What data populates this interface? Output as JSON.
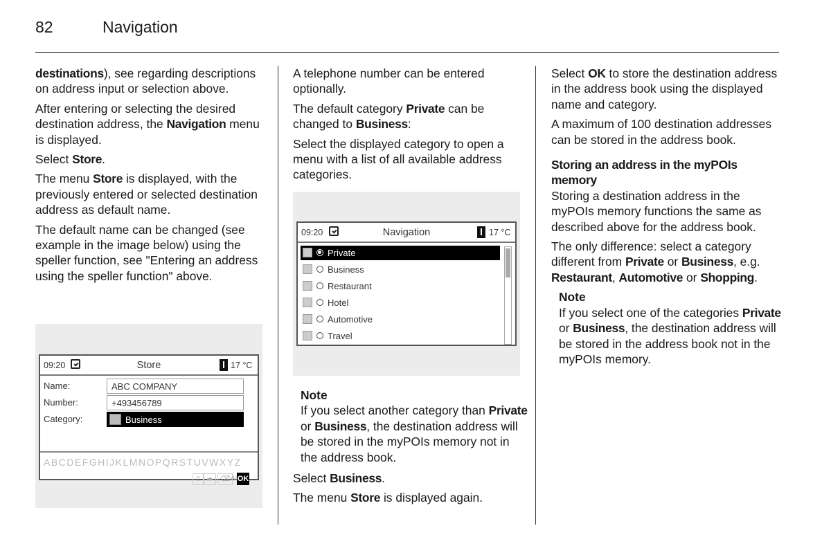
{
  "header": {
    "page_number": "82",
    "section_title": "Navigation"
  },
  "col1": {
    "p1_bold": "destinations",
    "p1_rest": "), see regarding descriptions on address input or selection above.",
    "p2_a": "After entering or selecting the desired destination address, the ",
    "p2_bold": "Navigation",
    "p2_b": " menu is displayed.",
    "p3_a": "Select ",
    "p3_bold": "Store",
    "p3_b": ".",
    "p4_a": "The menu ",
    "p4_bold": "Store",
    "p4_b": " is displayed, with the previously entered or selected destination address as default name.",
    "p5": "The default name can be changed (see example in the image below) using the speller function, see \"Entering an address using the speller function\" above."
  },
  "store_screen": {
    "time": "09:20",
    "title": "Store",
    "temperature": "17 °C",
    "fields": [
      {
        "label": "Name:",
        "value": "ABC COMPANY"
      },
      {
        "label": "Number:",
        "value": "+493456789"
      },
      {
        "label": "Category:",
        "value": "Business"
      }
    ],
    "alphabet": "ABCDEFGHIJKLMNOPQRSTUVWXYZ",
    "keys": {
      "shift": "⇧",
      "cursor": "◂▸",
      "backspace": "⌫",
      "case": "Aa",
      "ok": "OK"
    }
  },
  "col2": {
    "p1": "A telephone number can be entered optionally.",
    "p2_a": "The default category ",
    "p2_bold1": "Private",
    "p2_b": " can be changed to ",
    "p2_bold2": "Business",
    "p2_c": ":",
    "p3": "Select the displayed category to open a menu with a list of all available address categories.",
    "note_title": "Note",
    "note_a": "If you select another category than ",
    "note_bold1": "Private",
    "note_b": " or ",
    "note_bold2": "Business",
    "note_c": ", the destination address will be stored in the myPOIs memory not in the address book.",
    "p4_a": "Select ",
    "p4_bold": "Business",
    "p4_b": ".",
    "p5_a": "The menu ",
    "p5_bold": "Store",
    "p5_b": " is displayed again."
  },
  "nav_screen": {
    "time": "09:20",
    "title": "Navigation",
    "temperature": "17 °C",
    "categories": [
      "Private",
      "Business",
      "Restaurant",
      "Hotel",
      "Automotive",
      "Travel"
    ],
    "selected": "Private"
  },
  "col3": {
    "p1_a": "Select ",
    "p1_bold": "OK",
    "p1_b": " to store the destination address in the address book using the displayed name and category.",
    "p2": "A maximum of 100 destination addresses can be stored in the address book.",
    "subheading": "Storing an address in the myPOIs memory",
    "p3": "Storing a destination address in the myPOIs memory functions the same as described above for the address book.",
    "p4_a": "The only difference: select a category different from ",
    "p4_bold1": "Private",
    "p4_b": " or ",
    "p4_bold2": "Business",
    "p4_c": ", e.g. ",
    "p4_bold3": "Restaurant",
    "p4_d": ", ",
    "p4_bold4": "Automotive",
    "p4_e": " or ",
    "p4_bold5": "Shopping",
    "p4_f": ".",
    "note_title": "Note",
    "note_a": "If you select one of the categories ",
    "note_bold1": "Private",
    "note_b": " or ",
    "note_bold2": "Business",
    "note_c": ", the destination address will be stored in the address book not in the myPOIs memory."
  }
}
